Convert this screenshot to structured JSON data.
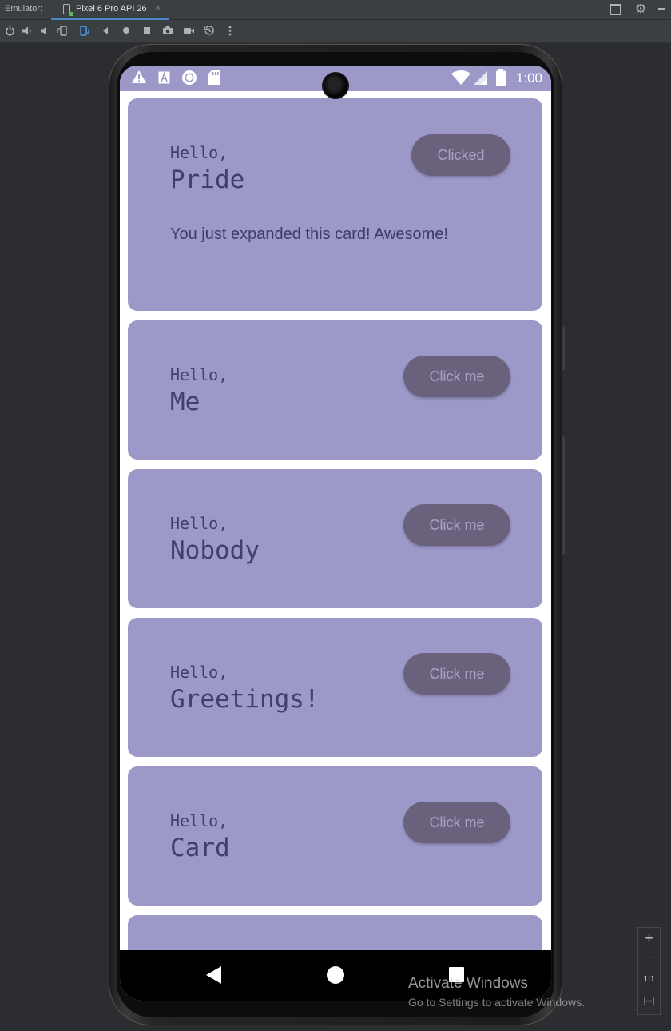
{
  "emulator": {
    "label": "Emulator:",
    "tab_title": "Pixel 6 Pro API 26",
    "tab_close": "×"
  },
  "toolbar_icons": [
    "power-icon",
    "volume-up-icon",
    "volume-down-icon",
    "rotate-left-icon",
    "rotate-right-icon",
    "back-icon",
    "home-icon",
    "overview-icon",
    "screenshot-icon",
    "screen-record-icon",
    "snapshot-icon",
    "more-icon"
  ],
  "status_bar": {
    "time": "1:00",
    "icons": [
      "warning-icon",
      "text-a-icon",
      "sync-icon",
      "sd-card-icon",
      "wifi-icon",
      "signal-icon",
      "battery-icon"
    ],
    "color": "#9c98c8"
  },
  "cards": [
    {
      "greeting": "Hello,",
      "name": "Pride",
      "button": "Clicked",
      "expanded": true,
      "expanded_text": "You just expanded this card! Awesome!"
    },
    {
      "greeting": "Hello,",
      "name": "Me",
      "button": "Click me",
      "expanded": false
    },
    {
      "greeting": "Hello,",
      "name": "Nobody",
      "button": "Click me",
      "expanded": false
    },
    {
      "greeting": "Hello,",
      "name": "Greetings!",
      "button": "Click me",
      "expanded": false
    },
    {
      "greeting": "Hello,",
      "name": "Card",
      "button": "Click me",
      "expanded": false
    }
  ],
  "colors": {
    "card": "#9c98c8",
    "button": "#6a627d",
    "button_text": "#a8a3c6",
    "text": "#423d6b"
  },
  "zoom": {
    "zoom_in": "+",
    "zoom_out": "−",
    "actual_size": "1:1"
  },
  "watermark": {
    "title": "Activate Windows",
    "subtitle": "Go to Settings to activate Windows."
  }
}
